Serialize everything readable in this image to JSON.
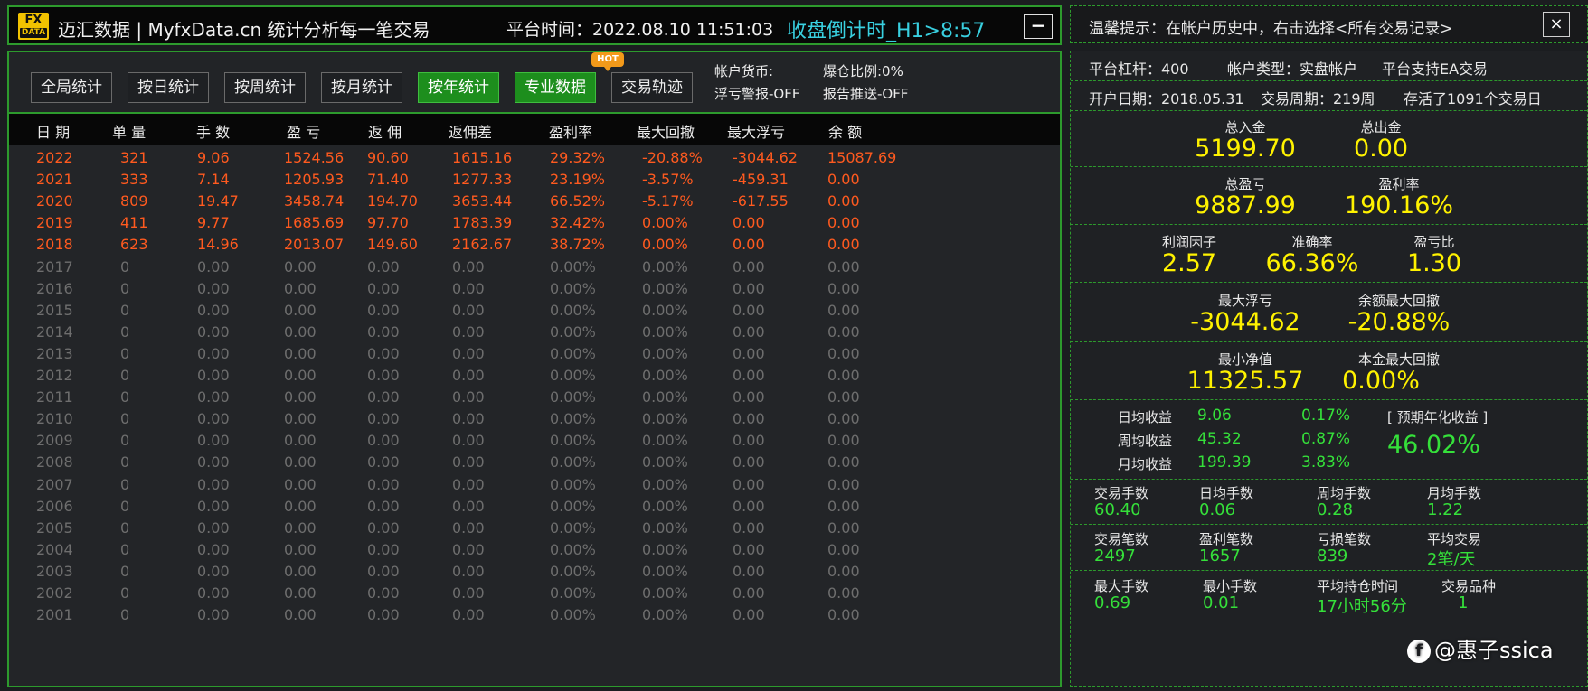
{
  "header": {
    "logo_line1": "FX",
    "logo_line2": "DATA",
    "app_title": "迈汇数据 | MyfxData.cn  统计分析每一笔交易",
    "platform_time": "平台时间：2022.08.10 11:51:03",
    "countdown": "收盘倒计时_H1>8:57",
    "minimize_label": "−"
  },
  "toolbar": {
    "buttons": [
      {
        "label": "全局统计",
        "active": false
      },
      {
        "label": "按日统计",
        "active": false
      },
      {
        "label": "按周统计",
        "active": false
      },
      {
        "label": "按月统计",
        "active": false
      },
      {
        "label": "按年统计",
        "active": true
      },
      {
        "label": "专业数据",
        "active": true
      },
      {
        "label": "交易轨迹",
        "active": false
      }
    ],
    "hot_badge": "HOT",
    "account_currency": "帐户货币:",
    "float_loss_alert": "浮亏警报-OFF",
    "margin_ratio": "爆仓比例:0%",
    "report_push": "报告推送-OFF"
  },
  "table": {
    "columns": [
      "日 期",
      "单 量",
      "手 数",
      "盈 亏",
      "返 佣",
      "返佣差",
      "盈利率",
      "最大回撤",
      "最大浮亏",
      "余 额"
    ],
    "rows": [
      {
        "cells": [
          "2022",
          "321",
          "9.06",
          "1524.56",
          "90.60",
          "1615.16",
          "29.32%",
          "-20.88%",
          "-3044.62",
          "15087.69"
        ],
        "active": true
      },
      {
        "cells": [
          "2021",
          "333",
          "7.14",
          "1205.93",
          "71.40",
          "1277.33",
          "23.19%",
          "-3.57%",
          "-459.31",
          "0.00"
        ],
        "active": true
      },
      {
        "cells": [
          "2020",
          "809",
          "19.47",
          "3458.74",
          "194.70",
          "3653.44",
          "66.52%",
          "-5.17%",
          "-617.55",
          "0.00"
        ],
        "active": true
      },
      {
        "cells": [
          "2019",
          "411",
          "9.77",
          "1685.69",
          "97.70",
          "1783.39",
          "32.42%",
          "0.00%",
          "0.00",
          "0.00"
        ],
        "active": true
      },
      {
        "cells": [
          "2018",
          "623",
          "14.96",
          "2013.07",
          "149.60",
          "2162.67",
          "38.72%",
          "0.00%",
          "0.00",
          "0.00"
        ],
        "active": true
      },
      {
        "cells": [
          "2017",
          "0",
          "0.00",
          "0.00",
          "0.00",
          "0.00",
          "0.00%",
          "0.00%",
          "0.00",
          "0.00"
        ],
        "active": false
      },
      {
        "cells": [
          "2016",
          "0",
          "0.00",
          "0.00",
          "0.00",
          "0.00",
          "0.00%",
          "0.00%",
          "0.00",
          "0.00"
        ],
        "active": false
      },
      {
        "cells": [
          "2015",
          "0",
          "0.00",
          "0.00",
          "0.00",
          "0.00",
          "0.00%",
          "0.00%",
          "0.00",
          "0.00"
        ],
        "active": false
      },
      {
        "cells": [
          "2014",
          "0",
          "0.00",
          "0.00",
          "0.00",
          "0.00",
          "0.00%",
          "0.00%",
          "0.00",
          "0.00"
        ],
        "active": false
      },
      {
        "cells": [
          "2013",
          "0",
          "0.00",
          "0.00",
          "0.00",
          "0.00",
          "0.00%",
          "0.00%",
          "0.00",
          "0.00"
        ],
        "active": false
      },
      {
        "cells": [
          "2012",
          "0",
          "0.00",
          "0.00",
          "0.00",
          "0.00",
          "0.00%",
          "0.00%",
          "0.00",
          "0.00"
        ],
        "active": false
      },
      {
        "cells": [
          "2011",
          "0",
          "0.00",
          "0.00",
          "0.00",
          "0.00",
          "0.00%",
          "0.00%",
          "0.00",
          "0.00"
        ],
        "active": false
      },
      {
        "cells": [
          "2010",
          "0",
          "0.00",
          "0.00",
          "0.00",
          "0.00",
          "0.00%",
          "0.00%",
          "0.00",
          "0.00"
        ],
        "active": false
      },
      {
        "cells": [
          "2009",
          "0",
          "0.00",
          "0.00",
          "0.00",
          "0.00",
          "0.00%",
          "0.00%",
          "0.00",
          "0.00"
        ],
        "active": false
      },
      {
        "cells": [
          "2008",
          "0",
          "0.00",
          "0.00",
          "0.00",
          "0.00",
          "0.00%",
          "0.00%",
          "0.00",
          "0.00"
        ],
        "active": false
      },
      {
        "cells": [
          "2007",
          "0",
          "0.00",
          "0.00",
          "0.00",
          "0.00",
          "0.00%",
          "0.00%",
          "0.00",
          "0.00"
        ],
        "active": false
      },
      {
        "cells": [
          "2006",
          "0",
          "0.00",
          "0.00",
          "0.00",
          "0.00",
          "0.00%",
          "0.00%",
          "0.00",
          "0.00"
        ],
        "active": false
      },
      {
        "cells": [
          "2005",
          "0",
          "0.00",
          "0.00",
          "0.00",
          "0.00",
          "0.00%",
          "0.00%",
          "0.00",
          "0.00"
        ],
        "active": false
      },
      {
        "cells": [
          "2004",
          "0",
          "0.00",
          "0.00",
          "0.00",
          "0.00",
          "0.00%",
          "0.00%",
          "0.00",
          "0.00"
        ],
        "active": false
      },
      {
        "cells": [
          "2003",
          "0",
          "0.00",
          "0.00",
          "0.00",
          "0.00",
          "0.00%",
          "0.00%",
          "0.00",
          "0.00"
        ],
        "active": false
      },
      {
        "cells": [
          "2002",
          "0",
          "0.00",
          "0.00",
          "0.00",
          "0.00",
          "0.00%",
          "0.00%",
          "0.00",
          "0.00"
        ],
        "active": false
      },
      {
        "cells": [
          "2001",
          "0",
          "0.00",
          "0.00",
          "0.00",
          "0.00",
          "0.00%",
          "0.00%",
          "0.00",
          "0.00"
        ],
        "active": false
      }
    ]
  },
  "tip": {
    "text": "温馨提示：在帐户历史中，右击选择<所有交易记录>",
    "close_label": "×"
  },
  "account": {
    "leverage": "平台杠杆：400",
    "account_type": "帐户类型：实盘帐户",
    "ea_support": "平台支持EA交易",
    "open_date": "开户日期：2018.05.31",
    "trade_period": "交易周期：219周",
    "survived": "存活了1091个交易日"
  },
  "stats": {
    "deposit_label": "总入金",
    "deposit_value": "5199.70",
    "withdraw_label": "总出金",
    "withdraw_value": "0.00",
    "total_pl_label": "总盈亏",
    "total_pl_value": "9887.99",
    "profit_rate_label": "盈利率",
    "profit_rate_value": "190.16%",
    "profit_factor_label": "利润因子",
    "profit_factor_value": "2.57",
    "accuracy_label": "准确率",
    "accuracy_value": "66.36%",
    "pl_ratio_label": "盈亏比",
    "pl_ratio_value": "1.30",
    "max_float_loss_label": "最大浮亏",
    "max_float_loss_value": "-3044.62",
    "balance_max_dd_label": "余额最大回撤",
    "balance_max_dd_value": "-20.88%",
    "min_equity_label": "最小净值",
    "min_equity_value": "11325.57",
    "principal_max_dd_label": "本金最大回撤",
    "principal_max_dd_value": "0.00%"
  },
  "returns": {
    "daily_label": "日均收益",
    "daily_value": "9.06",
    "daily_pct": "0.17%",
    "weekly_label": "周均收益",
    "weekly_value": "45.32",
    "weekly_pct": "0.87%",
    "monthly_label": "月均收益",
    "monthly_value": "199.39",
    "monthly_pct": "3.83%",
    "annual_label": "[ 预期年化收益 ]",
    "annual_value": "46.02%"
  },
  "lots": {
    "items": [
      {
        "label": "交易手数",
        "value": "60.40"
      },
      {
        "label": "日均手数",
        "value": "0.06"
      },
      {
        "label": "周均手数",
        "value": "0.28"
      },
      {
        "label": "月均手数",
        "value": "1.22"
      }
    ]
  },
  "trades": {
    "items": [
      {
        "label": "交易笔数",
        "value": "2497"
      },
      {
        "label": "盈利笔数",
        "value": "1657"
      },
      {
        "label": "亏损笔数",
        "value": "839"
      },
      {
        "label": "平均交易",
        "value": "2笔/天"
      }
    ]
  },
  "sizes": {
    "items": [
      {
        "label": "最大手数",
        "value": "0.69"
      },
      {
        "label": "最小手数",
        "value": "0.01"
      },
      {
        "label": "平均持仓时间",
        "value": "17小时56分"
      },
      {
        "label": "交易品种",
        "value": "1"
      }
    ]
  },
  "watermark": {
    "icon": "f",
    "text": "@惠子ssica"
  },
  "colors": {
    "accent_green": "#2d9a2d",
    "value_yellow": "#fff200",
    "value_green": "#35e03a",
    "active_row": "#ff5a1f",
    "countdown_cyan": "#39d0e0"
  }
}
